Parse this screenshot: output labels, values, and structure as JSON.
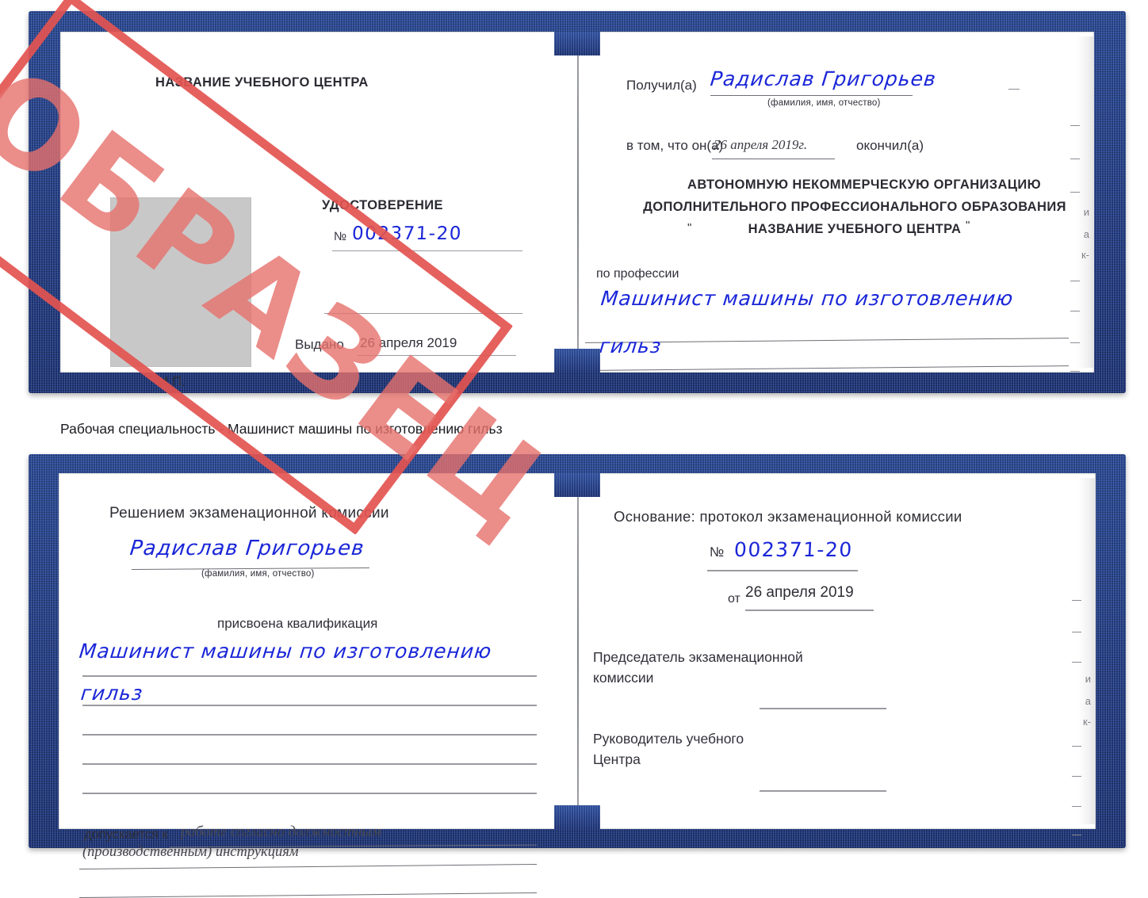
{
  "document": {
    "type": "Удостоверение",
    "caption": "Рабочая специальность - Машинист машины по изготовлению гильз",
    "stamp_label": "ОБРАЗЕЦ",
    "stamp_color": "#e6706b",
    "cover_color": "#24408a",
    "ink_color": "#1a26d8"
  },
  "top_spread": {
    "left_page": {
      "center_name_heading": "НАЗВАНИЕ УЧЕБНОГО ЦЕНТРА",
      "doc_title": "УДОСТОВЕРЕНИЕ",
      "number_symbol": "№",
      "number_value": "002371-20",
      "issued_label": "Выдано",
      "issued_date": "26 апреля 2019",
      "seal_label": "М.П."
    },
    "right_page": {
      "received_label": "Получил(а)",
      "received_name": "Радислав Григорьев",
      "name_hint": "(фамилия, имя, отчество)",
      "in_that_label": "в том, что он(а)",
      "completion_date": "26 апреля 2019г.",
      "finished_label": "окончил(а)",
      "org_line1": "АВТОНОМНУЮ НЕКОММЕРЧЕСКУЮ ОРГАНИЗАЦИЮ",
      "org_line2": "ДОПОЛНИТЕЛЬНОГО ПРОФЕССИОНАЛЬНОГО ОБРАЗОВАНИЯ",
      "org_quote_open": "\"",
      "org_line3": "НАЗВАНИЕ УЧЕБНОГО ЦЕНТРА",
      "org_quote_close": "\"",
      "profession_label": "по профессии",
      "profession_value_line1": "Машинист машины по изготовлению",
      "profession_value_line2": "гильз",
      "margin_bleed": [
        "и",
        "а",
        "к-"
      ]
    }
  },
  "bottom_spread": {
    "left_page": {
      "decision_heading": "Решением экзаменационной комиссии",
      "name_value": "Радислав Григорьев",
      "name_hint": "(фамилия, имя, отчество)",
      "qualification_label": "присвоена квалификация",
      "qualification_line1": "Машинист машины по изготовлению",
      "qualification_line2": "гильз",
      "admitted_label": "допускается к",
      "admitted_value_line1": "работе согласно должностным",
      "admitted_value_line2": "(производственным) инструкциям"
    },
    "right_page": {
      "basis_label": "Основание: протокол экзаменационной комиссии",
      "number_symbol": "№",
      "number_value": "002371-20",
      "from_label": "от",
      "from_date": "26 апреля 2019",
      "chairman_line1": "Председатель экзаменационной",
      "chairman_line2": "комиссии",
      "head_line1": "Руководитель учебного",
      "head_line2": "Центра",
      "margin_bleed": [
        "и",
        "а",
        "к-"
      ]
    }
  }
}
